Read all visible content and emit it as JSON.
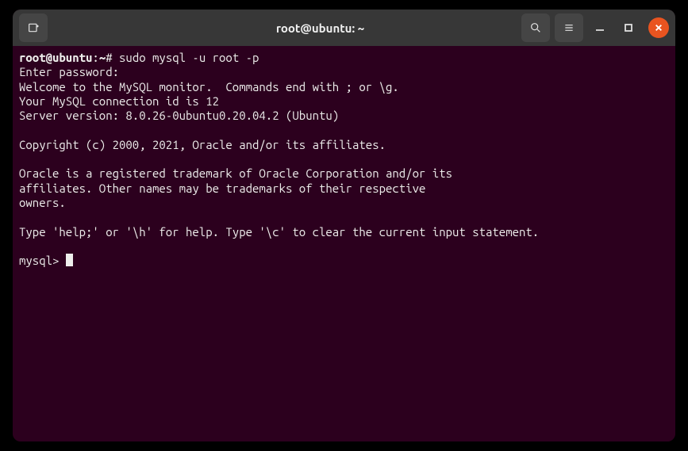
{
  "window": {
    "title": "root@ubuntu: ~"
  },
  "terminal": {
    "prompt_user": "root@ubuntu",
    "prompt_sep": ":",
    "prompt_path": "~",
    "prompt_char": "#",
    "command": "sudo mysql -u root -p",
    "lines": {
      "l1": "Enter password:",
      "l2": "Welcome to the MySQL monitor.  Commands end with ; or \\g.",
      "l3": "Your MySQL connection id is 12",
      "l4": "Server version: 8.0.26-0ubuntu0.20.04.2 (Ubuntu)",
      "l5": "",
      "l6": "Copyright (c) 2000, 2021, Oracle and/or its affiliates.",
      "l7": "",
      "l8": "Oracle is a registered trademark of Oracle Corporation and/or its",
      "l9": "affiliates. Other names may be trademarks of their respective",
      "l10": "owners.",
      "l11": "",
      "l12": "Type 'help;' or '\\h' for help. Type '\\c' to clear the current input statement.",
      "l13": ""
    },
    "mysql_prompt": "mysql> "
  }
}
